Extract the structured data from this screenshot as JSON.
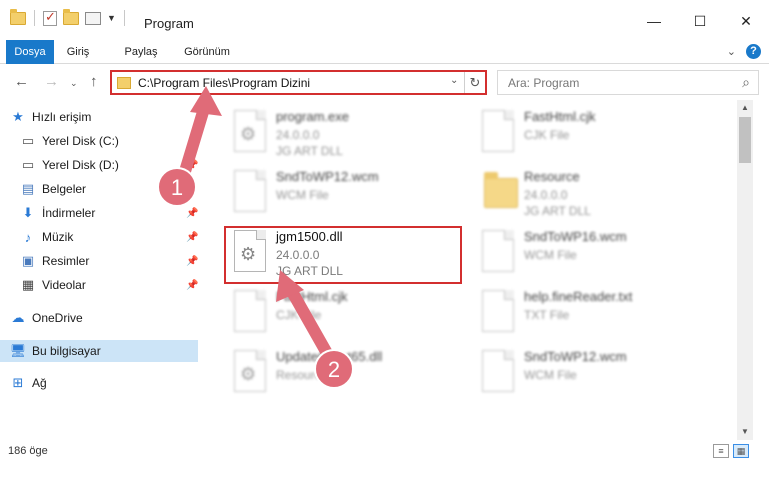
{
  "window": {
    "title": "Program",
    "minimize_icon": "minimize-icon",
    "maximize_icon": "maximize-icon",
    "close_icon": "close-icon"
  },
  "ribbon": {
    "tabs": [
      {
        "label": "Dosya"
      },
      {
        "label": "Giriş"
      },
      {
        "label": "Paylaş"
      },
      {
        "label": "Görünüm"
      }
    ],
    "help_label": "?"
  },
  "address": {
    "path": "C:\\Program Files\\Program Dizini",
    "search_placeholder": "Ara: Program"
  },
  "sidebar": {
    "items": [
      {
        "label": "Hızlı erişim",
        "icon": "star-icon"
      },
      {
        "label": "Yerel Disk (C:)",
        "icon": "drive-icon"
      },
      {
        "label": "Yerel Disk (D:)",
        "icon": "drive-icon"
      },
      {
        "label": "Belgeler",
        "icon": "documents-icon"
      },
      {
        "label": "İndirmeler",
        "icon": "download-icon"
      },
      {
        "label": "Müzik",
        "icon": "music-icon"
      },
      {
        "label": "Resimler",
        "icon": "pictures-icon"
      },
      {
        "label": "Videolar",
        "icon": "videos-icon"
      },
      {
        "label": "OneDrive",
        "icon": "cloud-icon"
      },
      {
        "label": "Bu bilgisayar",
        "icon": "computer-icon"
      },
      {
        "label": "Ağ",
        "icon": "network-icon"
      }
    ]
  },
  "files": [
    {
      "name": "program.exe",
      "line1": "24.0.0.0",
      "line2": "JG ART DLL",
      "icon": "exe-icon"
    },
    {
      "name": "FastHtml.cjk",
      "line1": "CJK File",
      "line2": "",
      "icon": "file-icon"
    },
    {
      "name": "SndToWP12.wcm",
      "line1": "WCM File",
      "line2": "",
      "icon": "file-icon"
    },
    {
      "name": "Resource",
      "line1": "24.0.0.0",
      "line2": "JG ART DLL",
      "icon": "folder-icon"
    },
    {
      "name": "jgm1500.dll",
      "line1": "24.0.0.0",
      "line2": "JG ART DLL",
      "icon": "dll-icon"
    },
    {
      "name": "SndToWP16.wcm",
      "line1": "WCM File",
      "line2": "",
      "icon": "file-icon"
    },
    {
      "name": "FastHtml.cjk",
      "line1": "CJK File",
      "line2": "",
      "icon": "file-icon"
    },
    {
      "name": "help.fineReader.txt",
      "line1": "TXT File",
      "line2": "",
      "icon": "file-icon"
    },
    {
      "name": "UpdateClient65.dll",
      "line1": "Resource",
      "line2": "",
      "icon": "dll-icon"
    },
    {
      "name": "SndToWP12.wcm",
      "line1": "WCM File",
      "line2": "",
      "icon": "file-icon"
    }
  ],
  "status": {
    "item_count": "186 öge"
  },
  "annotations": {
    "label1": "1",
    "label2": "2",
    "color": "#e06b78"
  }
}
